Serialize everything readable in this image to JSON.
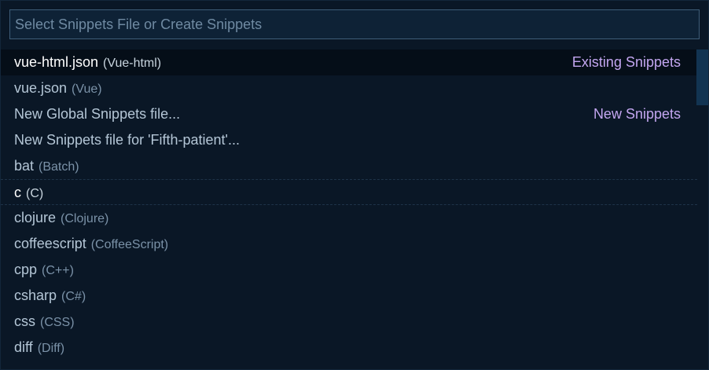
{
  "search": {
    "placeholder": "Select Snippets File or Create Snippets"
  },
  "items": [
    {
      "label": "vue-html.json",
      "desc": "(Vue-html)",
      "tag": "Existing Snippets"
    },
    {
      "label": "vue.json",
      "desc": "(Vue)",
      "tag": ""
    },
    {
      "label": "New Global Snippets file...",
      "desc": "",
      "tag": "New Snippets"
    },
    {
      "label": "New Snippets file for 'Fifth-patient'...",
      "desc": "",
      "tag": ""
    },
    {
      "label": "bat",
      "desc": "(Batch)",
      "tag": ""
    },
    {
      "label": "c",
      "desc": "(C)",
      "tag": ""
    },
    {
      "label": "clojure",
      "desc": "(Clojure)",
      "tag": ""
    },
    {
      "label": "coffeescript",
      "desc": "(CoffeeScript)",
      "tag": ""
    },
    {
      "label": "cpp",
      "desc": "(C++)",
      "tag": ""
    },
    {
      "label": "csharp",
      "desc": "(C#)",
      "tag": ""
    },
    {
      "label": "css",
      "desc": "(CSS)",
      "tag": ""
    },
    {
      "label": "diff",
      "desc": "(Diff)",
      "tag": ""
    }
  ]
}
